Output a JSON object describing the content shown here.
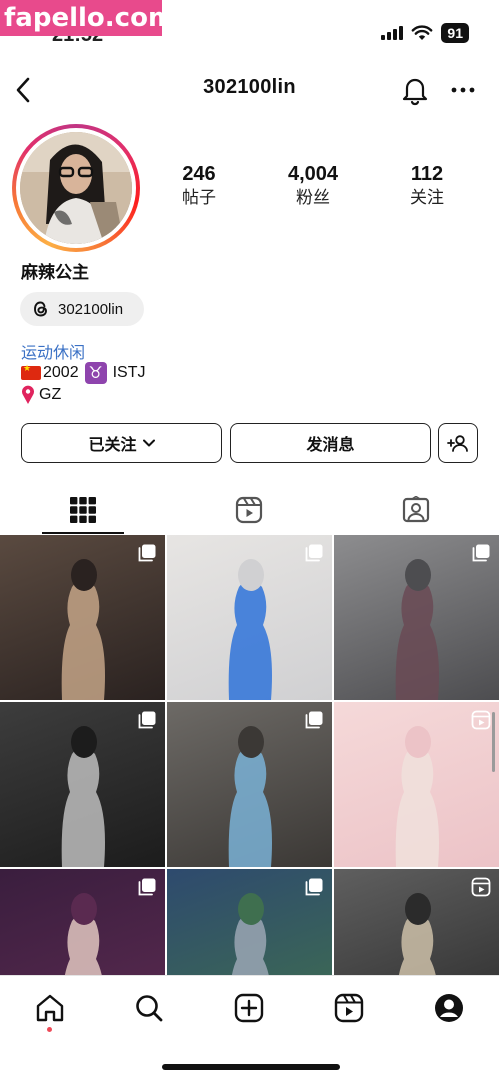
{
  "watermark": "fapello.com",
  "status_bar": {
    "time": "21:52",
    "battery": "91"
  },
  "header": {
    "username": "302100lin"
  },
  "profile": {
    "stats": [
      {
        "value": "246",
        "label": "帖子"
      },
      {
        "value": "4,004",
        "label": "粉丝"
      },
      {
        "value": "112",
        "label": "关注"
      }
    ],
    "name": "麻辣公主",
    "threads_handle": "302100lin",
    "category": "运动休闲",
    "bio_line1": "2002",
    "bio_mbti": "ISTJ",
    "bio_location": "GZ"
  },
  "actions": {
    "following_label": "已关注",
    "message_label": "发消息"
  },
  "tabs": [
    "grid-icon",
    "reels-icon",
    "tagged-icon"
  ],
  "grid_posts": [
    {
      "badge": "carousel",
      "palette": [
        "#5a4a40",
        "#2a2220",
        "#c4a487"
      ]
    },
    {
      "badge": "carousel",
      "palette": [
        "#e7e5e3",
        "#d0d0d2",
        "#2f73d9"
      ]
    },
    {
      "badge": "carousel",
      "palette": [
        "#8d8d8f",
        "#4d4d50",
        "#6a4a55"
      ]
    },
    {
      "badge": "carousel",
      "palette": [
        "#3d3d3d",
        "#1c1c1c",
        "#bdbdbd"
      ]
    },
    {
      "badge": "carousel",
      "palette": [
        "#6d6a66",
        "#3b3835",
        "#7ab2d6"
      ]
    },
    {
      "badge": "reel",
      "palette": [
        "#f5d9d9",
        "#ecc3c7",
        "#f0e0dc"
      ]
    },
    {
      "badge": "carousel",
      "palette": [
        "#3a1e3e",
        "#5a2a50",
        "#e0c6c0"
      ]
    },
    {
      "badge": "carousel",
      "palette": [
        "#2e4a6e",
        "#3f6f4f",
        "#9aa6b4"
      ]
    },
    {
      "badge": "reel",
      "palette": [
        "#5f5f5f",
        "#2b2b2b",
        "#cdbfa8"
      ]
    }
  ],
  "bottom_nav": [
    "home-icon",
    "search-icon",
    "create-icon",
    "reels-icon",
    "profile-icon"
  ],
  "colors": {
    "link": "#3b71c5",
    "notification_dot": "#ed4956"
  }
}
